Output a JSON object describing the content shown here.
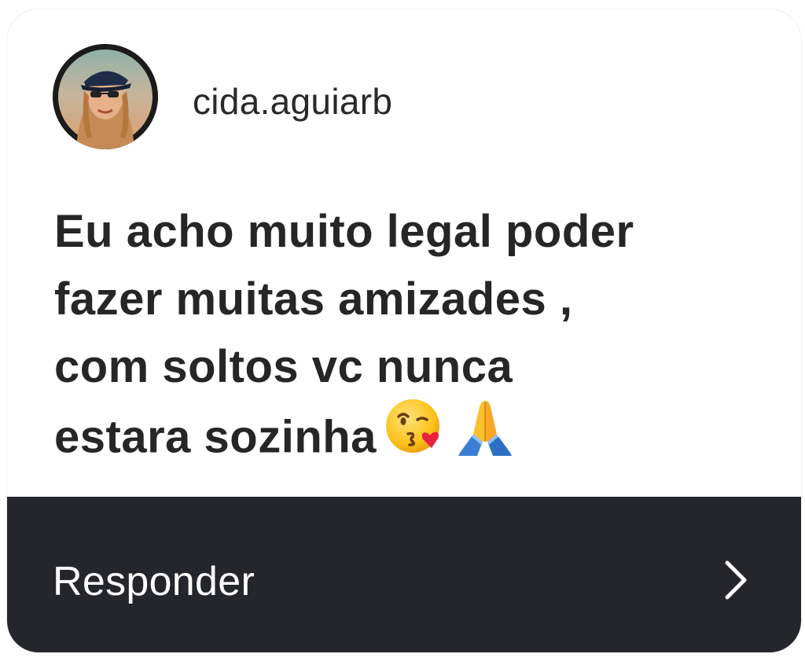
{
  "story_reply": {
    "username": "cida.aguiarb",
    "message_lines": [
      "Eu acho muito legal poder",
      "fazer muitas amizades ,",
      "com soltos vc nunca",
      "estara sozinha"
    ],
    "emojis": [
      "face-blowing-kiss",
      "folded-hands"
    ],
    "reply_label": "Responder",
    "reply_icon": "chevron-right-icon"
  },
  "colors": {
    "footer_background": "#25262b",
    "text": "#262626",
    "footer_text": "#ffffff"
  }
}
